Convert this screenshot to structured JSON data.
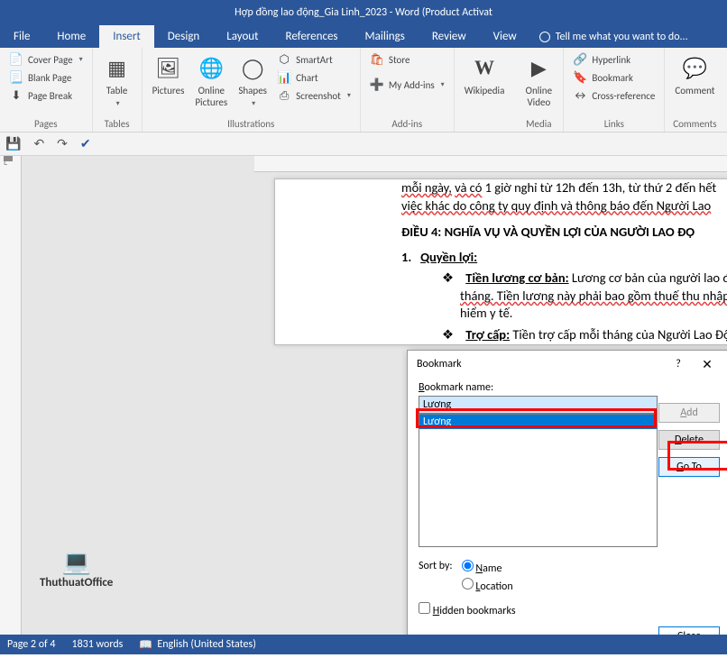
{
  "title": "Hợp đồng lao động_Gia Linh_2023 - Word (Product Activat",
  "menu": {
    "file": "File",
    "home": "Home",
    "insert": "Insert",
    "design": "Design",
    "layout": "Layout",
    "references": "References",
    "mailings": "Mailings",
    "review": "Review",
    "view": "View",
    "tellme": "Tell me what you want to do..."
  },
  "ribbon": {
    "pages": {
      "label": "Pages",
      "cover": "Cover Page",
      "blank": "Blank Page",
      "break": "Page Break"
    },
    "tables": {
      "label": "Tables",
      "table": "Table"
    },
    "illustrations": {
      "label": "Illustrations",
      "pictures": "Pictures",
      "online_pictures": "Online\nPictures",
      "shapes": "Shapes",
      "smartart": "SmartArt",
      "chart": "Chart",
      "screenshot": "Screenshot"
    },
    "addins": {
      "label": "Add-ins",
      "store": "Store",
      "myaddins": "My Add-ins"
    },
    "media": {
      "label": "Media",
      "wikipedia": "Wikipedia",
      "online_video": "Online\nVideo"
    },
    "links": {
      "label": "Links",
      "hyperlink": "Hyperlink",
      "bookmark": "Bookmark",
      "crossref": "Cross-reference"
    },
    "comments": {
      "label": "Comments",
      "comment": "Comment"
    }
  },
  "document": {
    "line1_a": "mỗi ngày,",
    "line1_b": "và có",
    "line1_c": "1 giờ nghỉ từ 12h đến 13h, từ thứ 2 đến hết",
    "line2": "việc khác do công ty quy định và thông báo đến Người Lao ",
    "heading": "ĐIỀU 4: NGHĨA VỤ VÀ QUYỀN LỢI CỦA NGƯỜI LAO ĐỘ",
    "item1_num": "1.",
    "item1_title": "Quyền lợi:",
    "b1_a": "Tiền lương cơ bản:",
    "b1_b": "Lương cơ bản của người lao độn",
    "b1_c": "tháng. Tiền lương này phải bao gồm thuế thu nhập",
    "b1_d": "hiểm y tế.",
    "b2_a": "Trợ cấp:",
    "b2_b": "Tiền trợ cấp mỗi tháng của Người Lao Độ"
  },
  "watermark": {
    "name": "ThuthuatOffice"
  },
  "dialog": {
    "title": "Bookmark",
    "help": "?",
    "name_label": "Bookmark name:",
    "name_value": "Lương",
    "list_item": "Lương",
    "btn_add": "Add",
    "btn_delete": "Delete",
    "btn_goto": "Go To",
    "sort_label": "Sort by:",
    "radio_name": "Name",
    "radio_location": "Location",
    "hidden": "Hidden bookmarks",
    "close": "Close"
  },
  "status": {
    "page": "Page 2 of 4",
    "words": "1831 words",
    "lang": "English (United States)"
  }
}
